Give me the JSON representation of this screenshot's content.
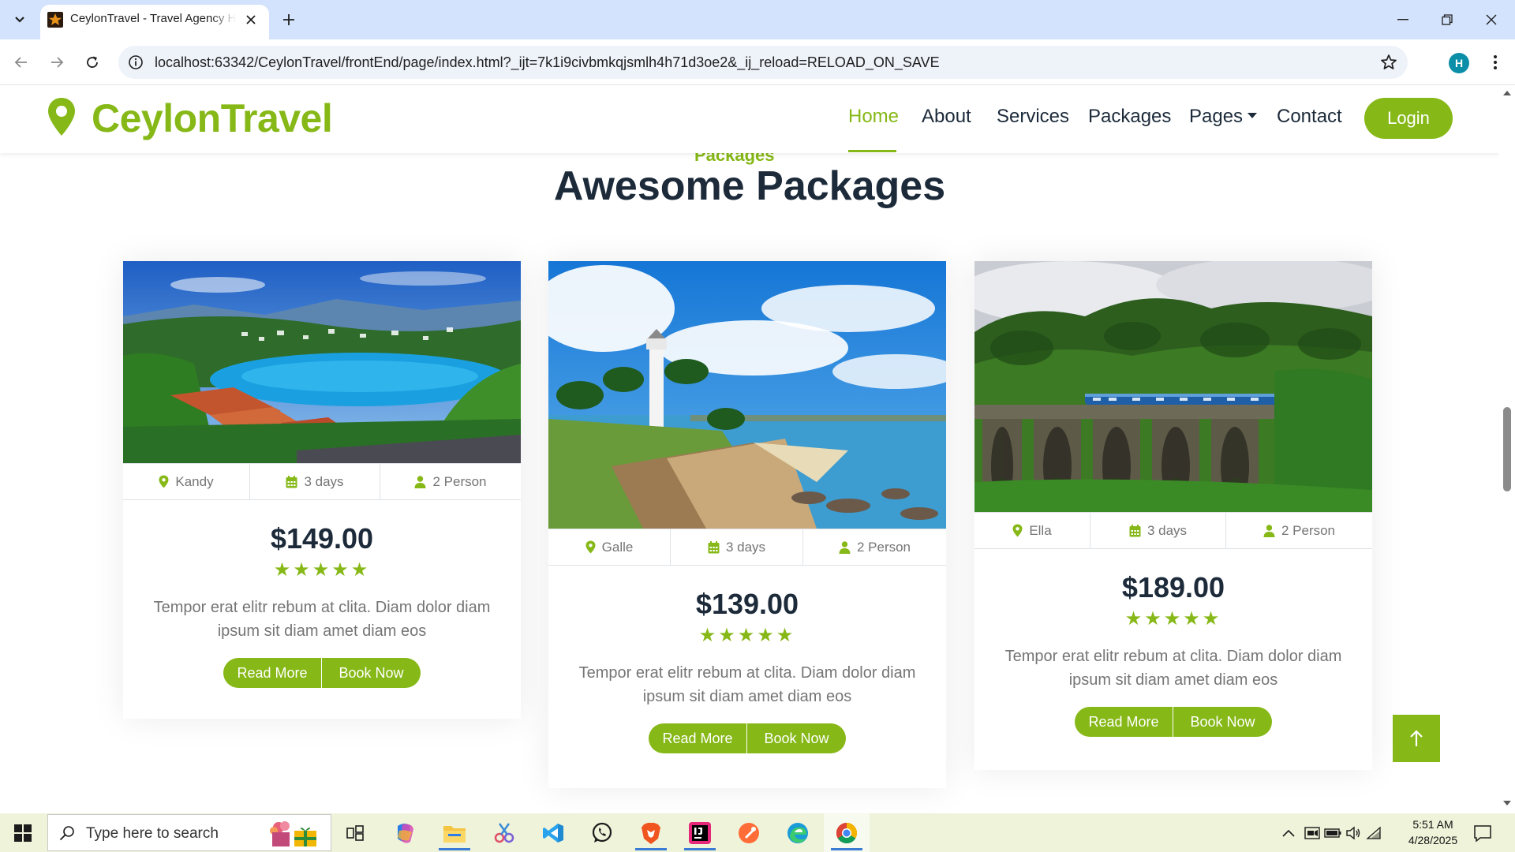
{
  "browser": {
    "tab_title": "CeylonTravel - Travel Agency HTML Template",
    "url": "localhost:63342/CeylonTravel/frontEnd/page/index.html?_ijt=7k1i9civbmkqjsmlh4h71d3oe2&_ij_reload=RELOAD_ON_SAVE",
    "profile_initial": "H"
  },
  "site": {
    "brand": "CeylonTravel",
    "brand_color": "#86b817",
    "nav": {
      "home": "Home",
      "about": "About",
      "services": "Services",
      "packages": "Packages",
      "pages": "Pages",
      "contact": "Contact",
      "login": "Login"
    }
  },
  "section": {
    "tag": "Packages",
    "title": "Awesome Packages"
  },
  "packages": [
    {
      "location": "Kandy",
      "duration": "3 days",
      "persons": "2 Person",
      "price": "$149.00",
      "rating": 5,
      "description": "Tempor erat elitr rebum at clita. Diam dolor diam ipsum sit diam amet diam eos",
      "read_more": "Read More",
      "book_now": "Book Now"
    },
    {
      "location": "Galle",
      "duration": "3 days",
      "persons": "2 Person",
      "price": "$139.00",
      "rating": 5,
      "description": "Tempor erat elitr rebum at clita. Diam dolor diam ipsum sit diam amet diam eos",
      "read_more": "Read More",
      "book_now": "Book Now"
    },
    {
      "location": "Ella",
      "duration": "3 days",
      "persons": "2 Person",
      "price": "$189.00",
      "rating": 5,
      "description": "Tempor erat elitr rebum at clita. Diam dolor diam ipsum sit diam amet diam eos",
      "read_more": "Read More",
      "book_now": "Book Now"
    }
  ],
  "taskbar": {
    "search_placeholder": "Type here to search",
    "time": "5:51 AM",
    "date": "4/28/2025",
    "apps": [
      "task-view",
      "copilot",
      "file-explorer",
      "snipping-tool",
      "vscode",
      "whatsapp",
      "brave",
      "intellij",
      "postman",
      "edge",
      "chrome"
    ]
  }
}
